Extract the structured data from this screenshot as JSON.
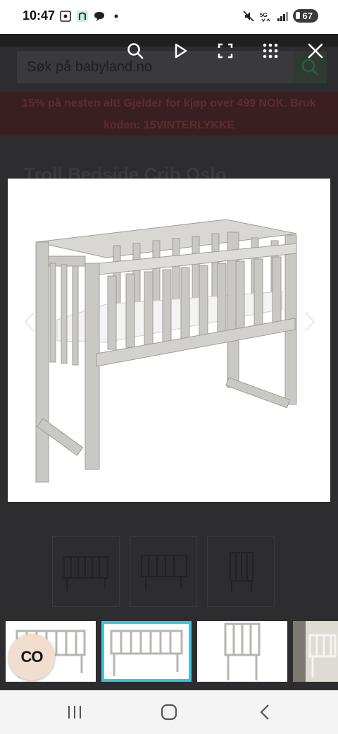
{
  "status_bar": {
    "time": "10:47",
    "battery": "67",
    "icons": [
      "screenshot-icon",
      "n-app-icon",
      "chat-icon",
      "dot-icon",
      "mute-icon",
      "5g-icon",
      "signal-icon",
      "battery-icon"
    ]
  },
  "background_page": {
    "search": {
      "placeholder": "Søk på babyland.no"
    },
    "banner": {
      "line1": "15% på nesten alt! Gjelder for kjøp over 499 NOK. Bruk",
      "line2": "koden: 15VINTERLYKKE"
    },
    "product_title": "Troll Bedside Crib Oslo"
  },
  "viewer_toolbar": {
    "buttons": [
      "search-icon",
      "play-icon",
      "fullscreen-icon",
      "grid-icon",
      "close-icon"
    ]
  },
  "gallery": {
    "selected_index": 1,
    "thumbnails": [
      "crib-angle-view",
      "crib-side-view",
      "crib-end-view",
      "crib-room-view"
    ],
    "accent_color": "#37c6e0"
  },
  "fab": {
    "label": "CO"
  },
  "nav_bar": {
    "buttons": [
      "recents-icon",
      "home-icon",
      "back-icon"
    ]
  }
}
